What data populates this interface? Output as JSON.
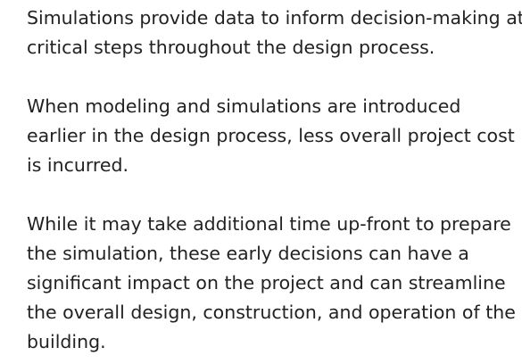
{
  "paragraphs": [
    {
      "lines": [
        "Simulations provide data to inform decision-making at",
        "critical steps throughout the design process."
      ]
    },
    {
      "lines": [
        "When modeling and simulations are introduced",
        "earlier in the design process, less overall project cost",
        "is incurred."
      ]
    },
    {
      "lines": [
        "While it may take additional time up-front to prepare",
        "the simulation, these early decisions can have a",
        "significant impact on the project and can streamline",
        "the overall design, construction, and operation of the",
        "building."
      ]
    }
  ]
}
